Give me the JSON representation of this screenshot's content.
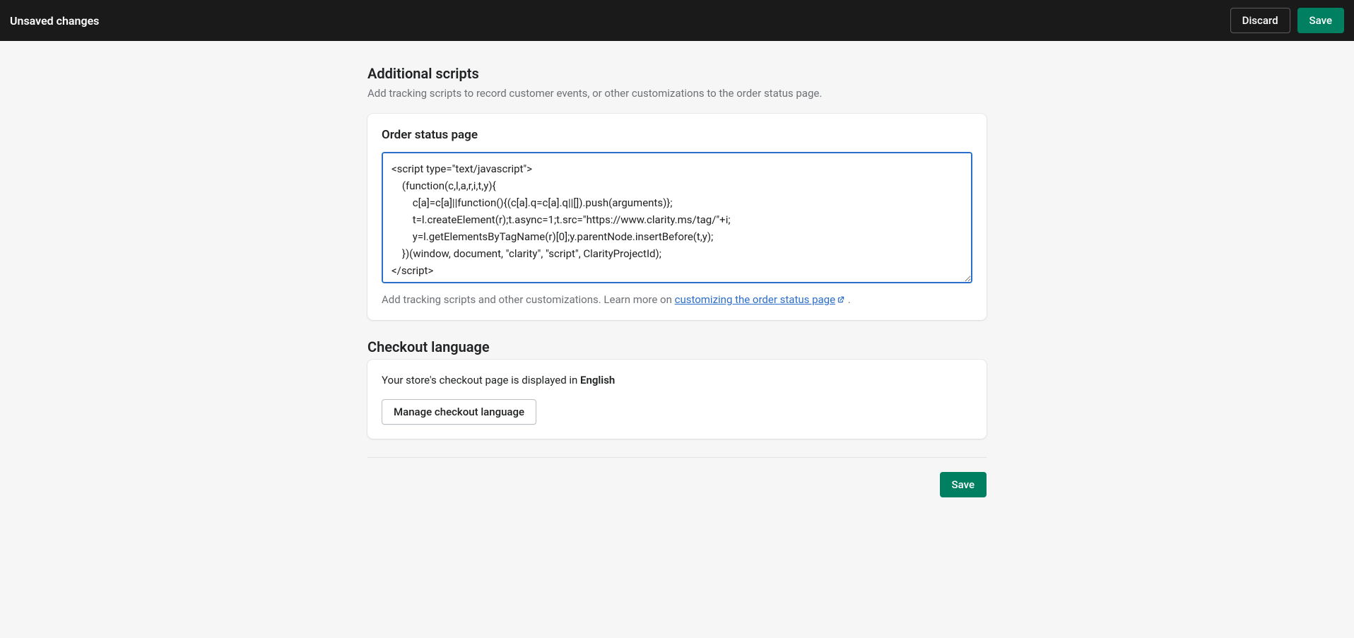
{
  "topbar": {
    "title": "Unsaved changes",
    "discard_label": "Discard",
    "save_label": "Save"
  },
  "additional_scripts": {
    "heading": "Additional scripts",
    "subtext": "Add tracking scripts to record customer events, or other customizations to the order status page.",
    "card_title": "Order status page",
    "textarea_value": "<script type=\"text/javascript\">\n    (function(c,l,a,r,i,t,y){\n        c[a]=c[a]||function(){(c[a].q=c[a].q||[]).push(arguments)};\n        t=l.createElement(r);t.async=1;t.src=\"https://www.clarity.ms/tag/\"+i;\n        y=l.getElementsByTagName(r)[0];y.parentNode.insertBefore(t,y);\n    })(window, document, \"clarity\", \"script\", ClarityProjectId);\n</script>",
    "helper_prefix": "Add tracking scripts and other customizations. Learn more on ",
    "helper_link": "customizing the order status page",
    "helper_suffix": " ."
  },
  "checkout_language": {
    "heading": "Checkout language",
    "text_prefix": "Your store's checkout page is displayed in ",
    "language": "English",
    "manage_button": "Manage checkout language"
  },
  "footer": {
    "save_label": "Save"
  }
}
